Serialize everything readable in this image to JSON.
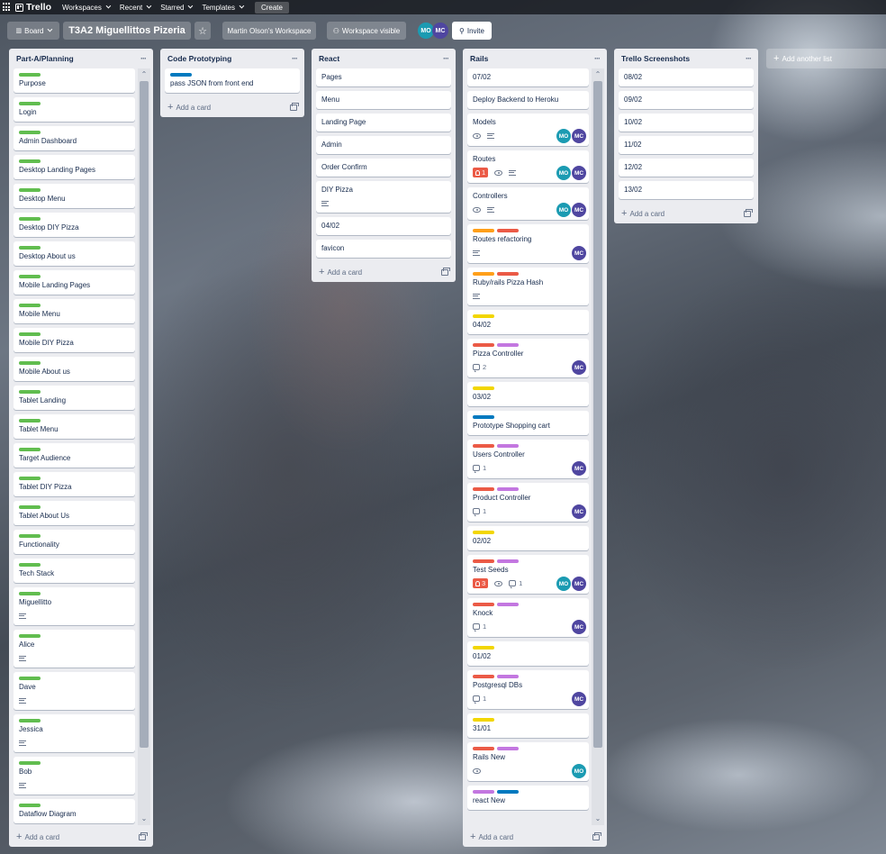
{
  "topbar": {
    "app_name": "Trello",
    "menus": [
      "Workspaces",
      "Recent",
      "Starred",
      "Templates"
    ],
    "create_label": "Create"
  },
  "board_header": {
    "view_label": "Board",
    "title": "T3A2 Miguellittos Pizeria",
    "workspace": "Martin Olson's Workspace",
    "visibility": "Workspace visible",
    "members": [
      "MO",
      "MC"
    ],
    "invite_label": "Invite"
  },
  "add_another_list": "Add another list",
  "add_card_label": "Add a card",
  "lists": {
    "planning": {
      "title": "Part-A/Planning",
      "cards": [
        {
          "title": "Purpose",
          "labels": [
            "green"
          ]
        },
        {
          "title": "Login",
          "labels": [
            "green"
          ]
        },
        {
          "title": "Admin Dashboard",
          "labels": [
            "green"
          ]
        },
        {
          "title": "Desktop Landing Pages",
          "labels": [
            "green"
          ]
        },
        {
          "title": "Desktop Menu",
          "labels": [
            "green"
          ]
        },
        {
          "title": "Desktop DIY Pizza",
          "labels": [
            "green"
          ]
        },
        {
          "title": "Desktop About us",
          "labels": [
            "green"
          ]
        },
        {
          "title": "Mobile Landing Pages",
          "labels": [
            "green"
          ]
        },
        {
          "title": "Mobile Menu",
          "labels": [
            "green"
          ]
        },
        {
          "title": "Mobile DIY Pizza",
          "labels": [
            "green"
          ]
        },
        {
          "title": "Mobile About us",
          "labels": [
            "green"
          ]
        },
        {
          "title": "Tablet Landing",
          "labels": [
            "green"
          ]
        },
        {
          "title": "Tablet Menu",
          "labels": [
            "green"
          ]
        },
        {
          "title": "Target Audience",
          "labels": [
            "green"
          ]
        },
        {
          "title": "Tablet DIY Pizza",
          "labels": [
            "green"
          ]
        },
        {
          "title": "Tablet About Us",
          "labels": [
            "green"
          ]
        },
        {
          "title": "Functionality",
          "labels": [
            "green"
          ]
        },
        {
          "title": "Tech Stack",
          "labels": [
            "green"
          ]
        },
        {
          "title": "Miguellitto",
          "labels": [
            "green"
          ],
          "desc": true
        },
        {
          "title": "Alice",
          "labels": [
            "green"
          ],
          "desc": true
        },
        {
          "title": "Dave",
          "labels": [
            "green"
          ],
          "desc": true
        },
        {
          "title": "Jessica",
          "labels": [
            "green"
          ],
          "desc": true
        },
        {
          "title": "Bob",
          "labels": [
            "green"
          ],
          "desc": true
        },
        {
          "title": "Dataflow Diagram",
          "labels": [
            "green"
          ]
        },
        {
          "title": "",
          "labels": [
            "yellow"
          ]
        }
      ]
    },
    "code": {
      "title": "Code Prototyping",
      "cards": [
        {
          "title": "pass JSON from front end",
          "labels": [
            "blue"
          ]
        }
      ]
    },
    "react": {
      "title": "React",
      "cards": [
        {
          "title": "Pages",
          "labels": []
        },
        {
          "title": "Menu",
          "labels": []
        },
        {
          "title": "Landing Page",
          "labels": []
        },
        {
          "title": "Admin",
          "labels": []
        },
        {
          "title": "Order Confirm",
          "labels": []
        },
        {
          "title": "DIY Pizza",
          "labels": [],
          "desc": true
        },
        {
          "title": "04/02",
          "labels": []
        },
        {
          "title": "favicon",
          "labels": []
        }
      ]
    },
    "rails": {
      "title": "Rails",
      "cards": [
        {
          "title": "07/02",
          "labels": []
        },
        {
          "title": "Deploy Backend to Heroku",
          "labels": []
        },
        {
          "title": "Models",
          "labels": [],
          "watch": true,
          "desc": true,
          "members": [
            "MO",
            "MC"
          ]
        },
        {
          "title": "Routes",
          "labels": [],
          "due": "1",
          "watch": true,
          "desc": true,
          "members": [
            "MO",
            "MC"
          ]
        },
        {
          "title": "Controllers",
          "labels": [],
          "watch": true,
          "desc": true,
          "members": [
            "MO",
            "MC"
          ]
        },
        {
          "title": "Routes refactoring",
          "labels": [
            "orange",
            "red"
          ],
          "desc": true,
          "members": [
            "MC"
          ]
        },
        {
          "title": "Ruby/rails Pizza Hash",
          "labels": [
            "orange",
            "red"
          ],
          "desc": true
        },
        {
          "title": "04/02",
          "labels": [
            "yellow"
          ]
        },
        {
          "title": "Pizza Controller",
          "labels": [
            "red",
            "purple"
          ],
          "comments": "2",
          "members": [
            "MC"
          ]
        },
        {
          "title": "03/02",
          "labels": [
            "yellow"
          ]
        },
        {
          "title": "Prototype Shopping cart",
          "labels": [
            "blue"
          ]
        },
        {
          "title": "Users Controller",
          "labels": [
            "red",
            "purple"
          ],
          "comments": "1",
          "members": [
            "MC"
          ]
        },
        {
          "title": "Product Controller",
          "labels": [
            "red",
            "purple"
          ],
          "comments": "1",
          "members": [
            "MC"
          ]
        },
        {
          "title": "02/02",
          "labels": [
            "yellow"
          ]
        },
        {
          "title": "Test Seeds",
          "labels": [
            "red",
            "purple"
          ],
          "due": "3",
          "watch": true,
          "comments": "1",
          "members": [
            "MO",
            "MC"
          ]
        },
        {
          "title": "Knock",
          "labels": [
            "red",
            "purple"
          ],
          "comments": "1",
          "members": [
            "MC"
          ]
        },
        {
          "title": "01/02",
          "labels": [
            "yellow"
          ]
        },
        {
          "title": "Postgresql DBs",
          "labels": [
            "red",
            "purple"
          ],
          "comments": "1",
          "members": [
            "MC"
          ]
        },
        {
          "title": "31/01",
          "labels": [
            "yellow"
          ]
        },
        {
          "title": "Rails New",
          "labels": [
            "red",
            "purple"
          ],
          "watch": true,
          "members": [
            "MO"
          ]
        },
        {
          "title": "react New",
          "labels": [
            "purple",
            "blue"
          ]
        }
      ]
    },
    "screens": {
      "title": "Trello Screenshots",
      "cards": [
        {
          "title": "08/02",
          "labels": []
        },
        {
          "title": "09/02",
          "labels": []
        },
        {
          "title": "10/02",
          "labels": []
        },
        {
          "title": "11/02",
          "labels": []
        },
        {
          "title": "12/02",
          "labels": []
        },
        {
          "title": "13/02",
          "labels": []
        }
      ]
    }
  }
}
